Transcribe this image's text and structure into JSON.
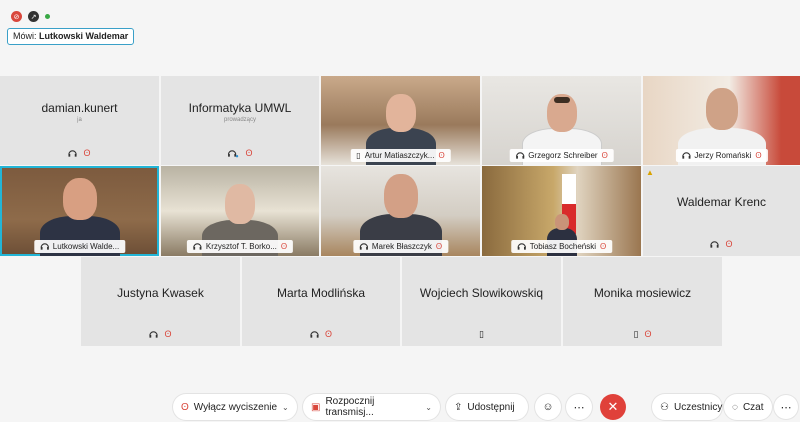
{
  "speaker": {
    "prefix": "Mówi:",
    "name": "Lutkowski Waldemar"
  },
  "row1": {
    "damian": {
      "name": "damian.kunert",
      "sub": "ja"
    },
    "informatyka": {
      "name": "Informatyka UMWL",
      "sub": "prowadzący"
    },
    "artur": "Artur Matiaszczyk...",
    "grzegorz": "Grzegorz Schreiber",
    "jerzy": "Jerzy Romański"
  },
  "row2": {
    "lutkowski": "Lutkowski Walde...",
    "krzysztof": "Krzysztof T. Borko...",
    "marek": "Marek Błaszczyk",
    "tobiasz": "Tobiasz Bocheński",
    "waldemar": "Waldemar Krenc"
  },
  "row3": {
    "justyna": "Justyna Kwasek",
    "marta": "Marta Modlińska",
    "wojciech": "Wojciech Slowikowskiq",
    "monika": "Monika mosiewicz"
  },
  "toolbar": {
    "mute": "Wyłącz wyciszenie",
    "record": "Rozpocznij transmisj...",
    "share": "Udostępnij",
    "participants": "Uczestnicy",
    "chat": "Czat"
  }
}
